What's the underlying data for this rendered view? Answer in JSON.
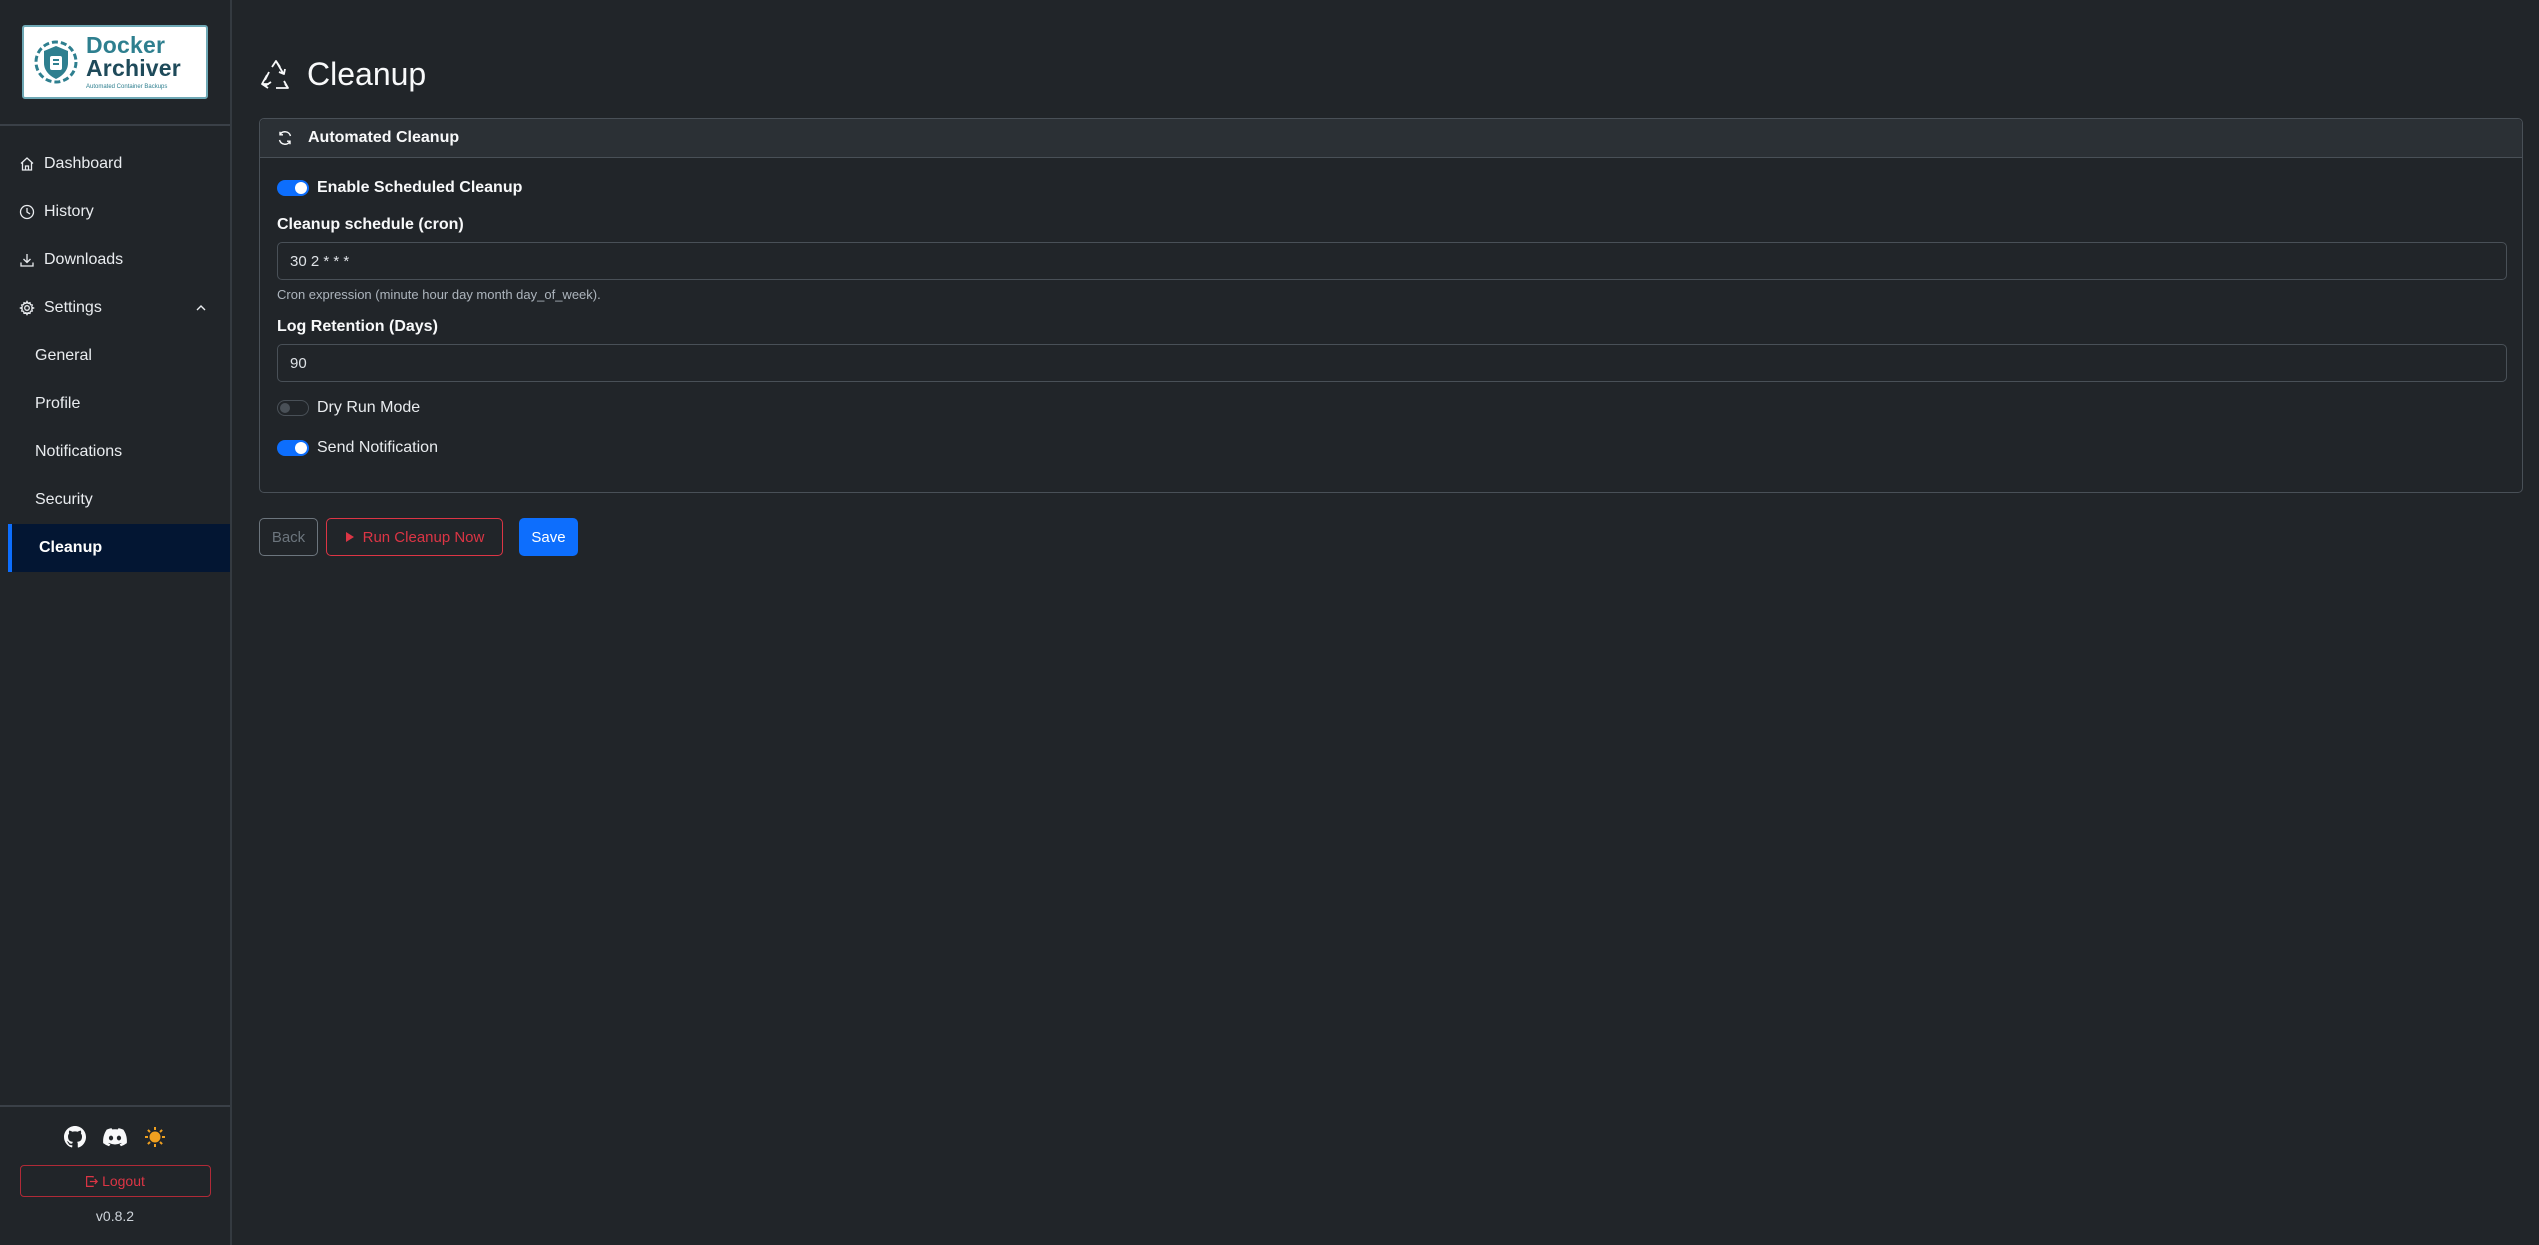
{
  "logo": {
    "line1": "Docker",
    "line2": "Archiver",
    "tagline": "Automated Container Backups"
  },
  "sidebar": {
    "items": [
      {
        "label": "Dashboard",
        "icon": "home-icon"
      },
      {
        "label": "History",
        "icon": "clock-icon"
      },
      {
        "label": "Downloads",
        "icon": "download-icon"
      },
      {
        "label": "Settings",
        "icon": "gear-icon",
        "expanded": true
      }
    ],
    "sub_items": [
      {
        "label": "General"
      },
      {
        "label": "Profile"
      },
      {
        "label": "Notifications"
      },
      {
        "label": "Security"
      },
      {
        "label": "Cleanup",
        "active": true
      }
    ],
    "logout_label": "Logout",
    "version": "v0.8.2",
    "social": [
      "github-icon",
      "discord-icon",
      "theme-sun-icon"
    ]
  },
  "page": {
    "title": "Cleanup",
    "icon": "recycle-icon"
  },
  "card": {
    "header": "Automated Cleanup",
    "enable_label": "Enable Scheduled Cleanup",
    "enable_on": true,
    "schedule_label": "Cleanup schedule (cron)",
    "schedule_value": "30 2 * * *",
    "schedule_help": "Cron expression (minute hour day month day_of_week).",
    "retention_label": "Log Retention (Days)",
    "retention_value": "90",
    "dry_run_label": "Dry Run Mode",
    "dry_run_on": false,
    "notify_label": "Send Notification",
    "notify_on": true
  },
  "actions": {
    "back": "Back",
    "run": "Run Cleanup Now",
    "save": "Save"
  },
  "colors": {
    "primary": "#0d6efd",
    "danger": "#dc3545",
    "background": "#212529",
    "active_nav": "#031633"
  }
}
